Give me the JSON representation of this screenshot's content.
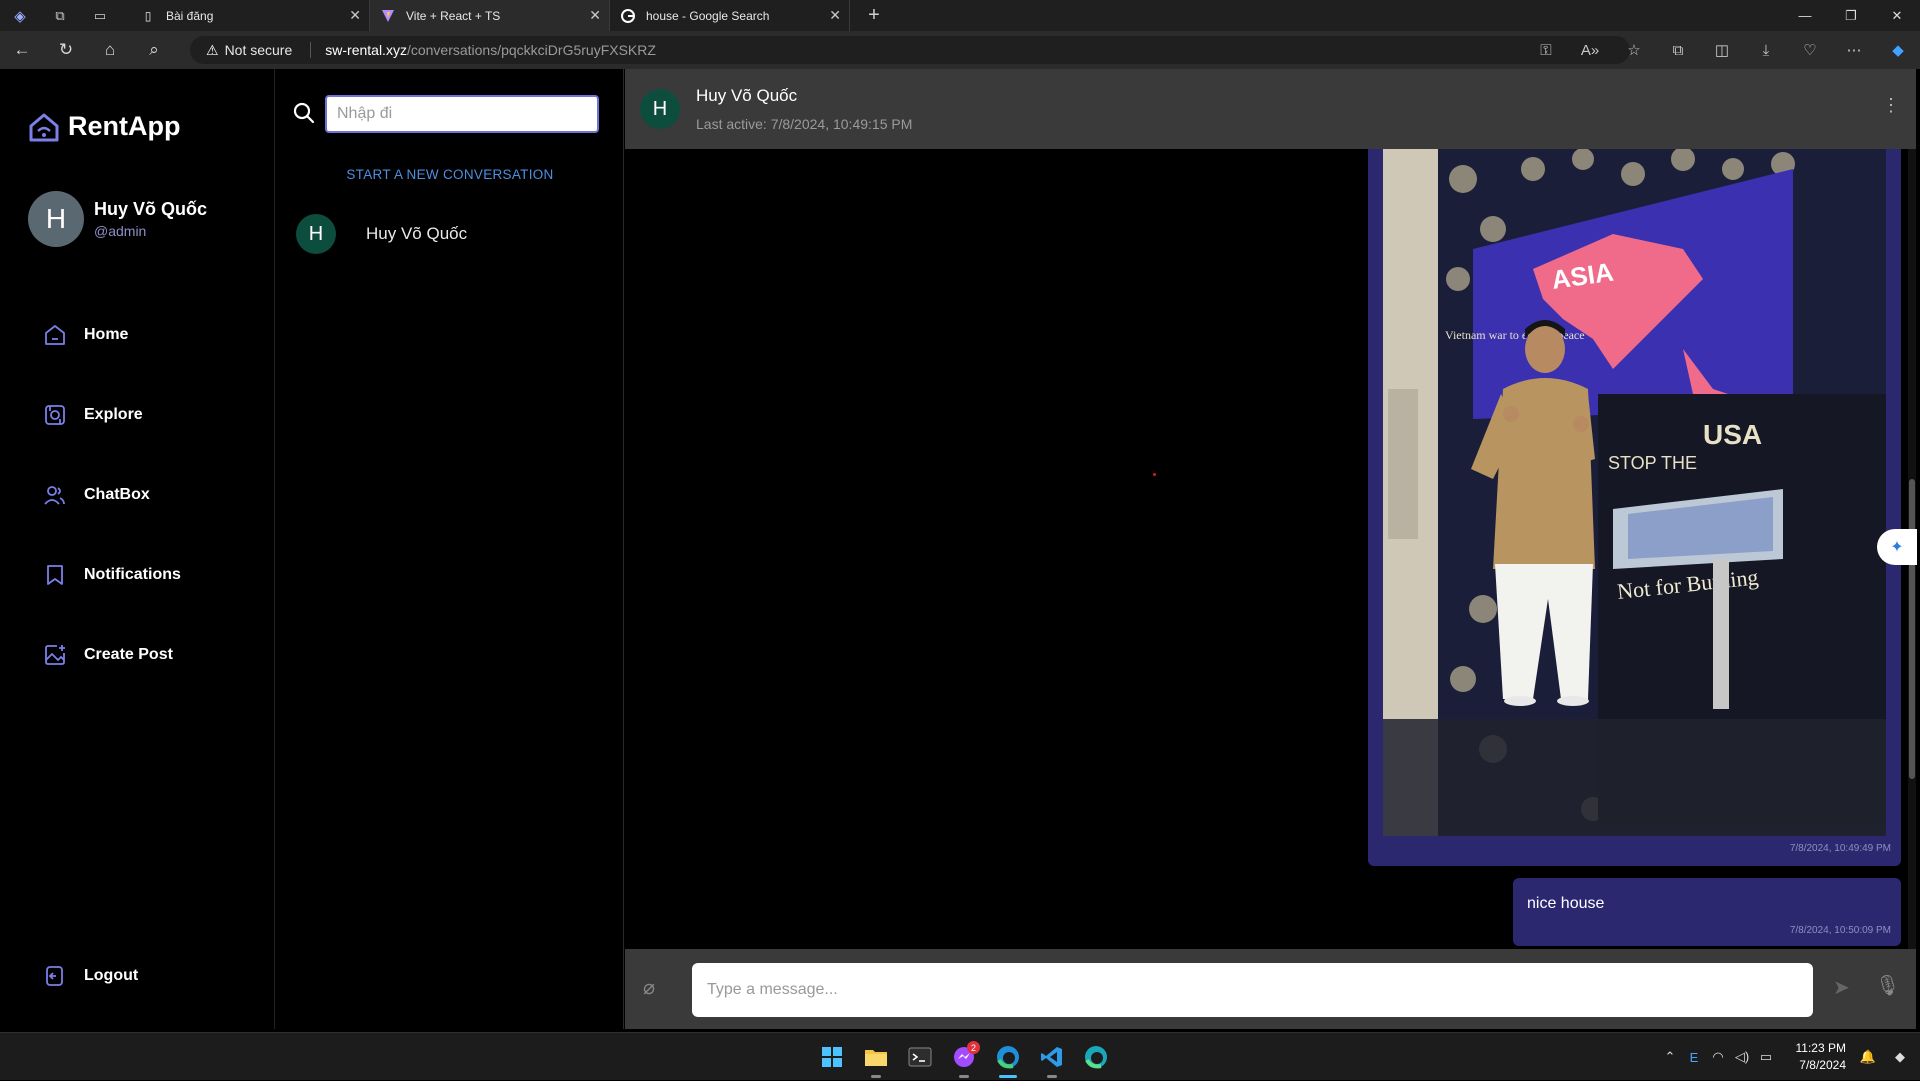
{
  "browser": {
    "tabs": [
      {
        "title": "Bài đăng",
        "icon": "page-icon"
      },
      {
        "title": "Vite + React + TS",
        "icon": "vite-icon"
      },
      {
        "title": "house - Google Search",
        "icon": "google-icon"
      }
    ],
    "security_label": "Not secure",
    "url_host": "sw-rental.xyz",
    "url_path": "/conversations/pqckkciDrG5ruyFXSKRZ"
  },
  "sidebar": {
    "app_name": "RentApp",
    "user": {
      "initial": "H",
      "name": "Huy Võ Quốc",
      "handle": "@admin"
    },
    "nav": [
      {
        "label": "Home",
        "icon": "home-icon"
      },
      {
        "label": "Explore",
        "icon": "explore-icon"
      },
      {
        "label": "ChatBox",
        "icon": "chat-users-icon"
      },
      {
        "label": "Notifications",
        "icon": "bookmark-bell-icon"
      },
      {
        "label": "Create Post",
        "icon": "image-plus-icon"
      }
    ],
    "logout_label": "Logout"
  },
  "conversations": {
    "search_placeholder": "Nhập đi",
    "start_new_label": "START A NEW CONVERSATION",
    "items": [
      {
        "initial": "H",
        "name": "Huy Võ Quốc"
      }
    ]
  },
  "chat": {
    "contact": {
      "initial": "H",
      "name": "Huy Võ Quốc",
      "status": "Last active: 7/8/2024, 10:49:15 PM"
    },
    "messages": [
      {
        "type": "image",
        "image_text": [
          "ASIA",
          "USA",
          "STOP THE",
          "Not for Burning",
          "Vietnam war to end all peace"
        ],
        "timestamp": "7/8/2024, 10:49:49 PM"
      },
      {
        "type": "text",
        "text": "nice house",
        "timestamp": "7/8/2024, 10:50:09 PM"
      }
    ],
    "composer_placeholder": "Type a message..."
  },
  "taskbar": {
    "messenger_badge": "2",
    "time": "11:23 PM",
    "date": "7/8/2024"
  },
  "colors": {
    "accent": "#6f73d8",
    "bubble": "#2b2870",
    "link": "#4d8fe0",
    "avatar_green": "#0d4d3d",
    "header_bg": "#3a3a3a"
  }
}
